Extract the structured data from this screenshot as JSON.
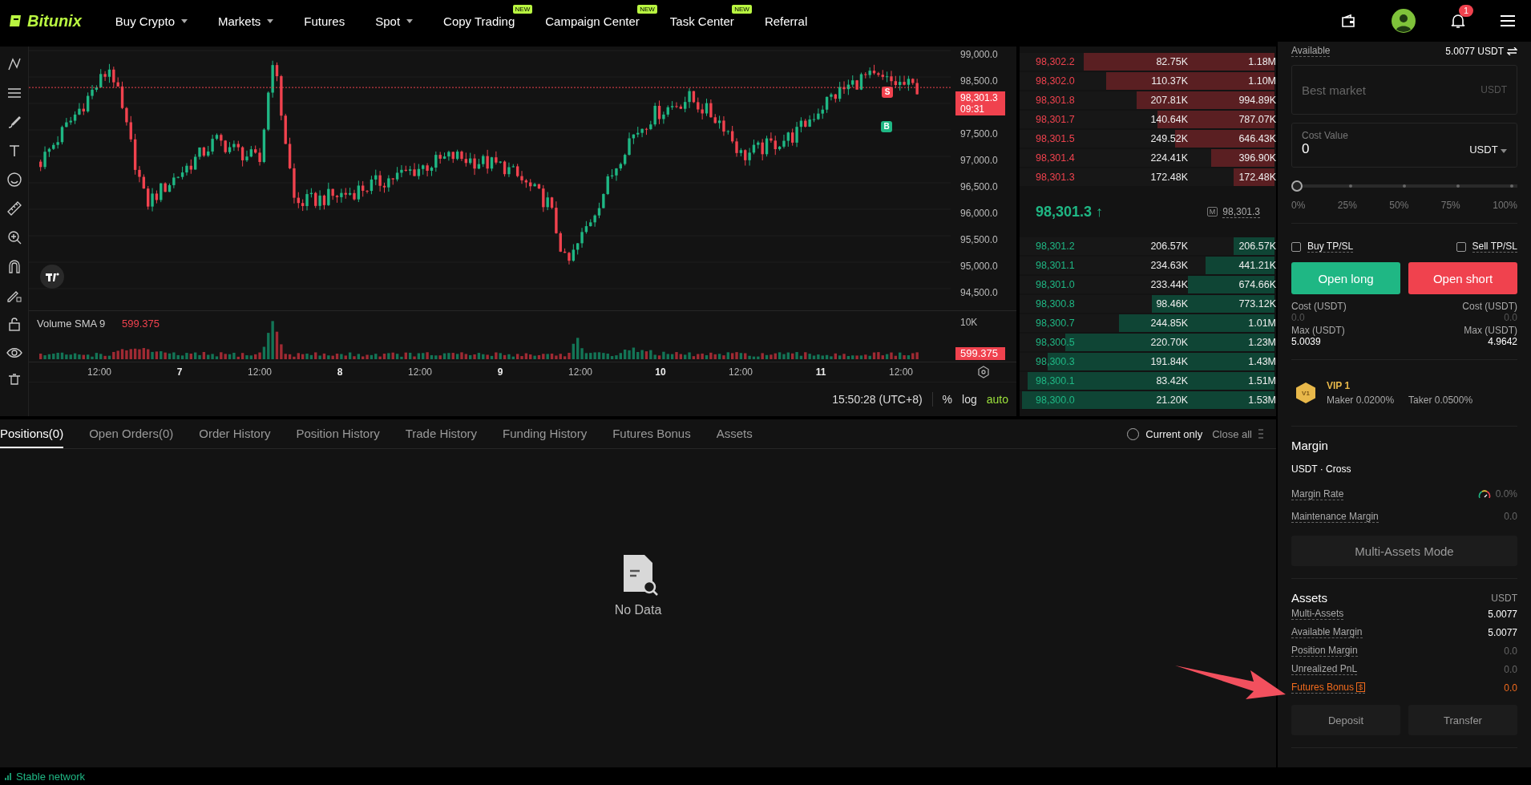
{
  "nav": {
    "logo": "Bitunix",
    "items": [
      {
        "label": "Buy Crypto",
        "dropdown": true
      },
      {
        "label": "Markets",
        "dropdown": true
      },
      {
        "label": "Futures",
        "dropdown": false
      },
      {
        "label": "Spot",
        "dropdown": true
      },
      {
        "label": "Copy Trading",
        "dropdown": false,
        "badge": "NEW"
      },
      {
        "label": "Campaign Center",
        "dropdown": false,
        "badge": "NEW"
      },
      {
        "label": "Task Center",
        "dropdown": false,
        "badge": "NEW"
      },
      {
        "label": "Referral",
        "dropdown": false
      }
    ],
    "notification_count": "1"
  },
  "chart": {
    "price_axis": [
      "99,000.0",
      "98,500.0",
      "97,500.0",
      "97,000.0",
      "96,500.0",
      "96,000.0",
      "95,500.0",
      "95,000.0",
      "94,500.0"
    ],
    "price_tag": {
      "price": "98,301.3",
      "countdown": "09:31"
    },
    "trade_markers": [
      {
        "label": "S",
        "kind": "sell"
      },
      {
        "label": "B",
        "kind": "buy"
      }
    ],
    "volume": {
      "label": "Volume SMA 9",
      "value": "599.375",
      "axis_label": "10K",
      "tag": "599.375"
    },
    "time_axis": [
      {
        "label": "12:00",
        "day": false
      },
      {
        "label": "7",
        "day": true
      },
      {
        "label": "12:00",
        "day": false
      },
      {
        "label": "8",
        "day": true
      },
      {
        "label": "12:00",
        "day": false
      },
      {
        "label": "9",
        "day": true
      },
      {
        "label": "12:00",
        "day": false
      },
      {
        "label": "10",
        "day": true
      },
      {
        "label": "12:00",
        "day": false
      },
      {
        "label": "11",
        "day": true
      },
      {
        "label": "12:00",
        "day": false
      }
    ],
    "clock": "15:50:28 (UTC+8)",
    "scale_options": [
      {
        "label": "%",
        "selected": false
      },
      {
        "label": "log",
        "selected": false
      },
      {
        "label": "auto",
        "selected": true
      }
    ]
  },
  "order_book": {
    "asks": [
      {
        "price": "98,302.2",
        "amount": "82.75K",
        "total": "1.18M",
        "level": 0.75
      },
      {
        "price": "98,302.0",
        "amount": "110.37K",
        "total": "1.10M",
        "level": 0.66
      },
      {
        "price": "98,301.8",
        "amount": "207.81K",
        "total": "994.89K",
        "level": 0.54
      },
      {
        "price": "98,301.7",
        "amount": "140.64K",
        "total": "787.07K",
        "level": 0.46
      },
      {
        "price": "98,301.5",
        "amount": "249.52K",
        "total": "646.43K",
        "level": 0.39
      },
      {
        "price": "98,301.4",
        "amount": "224.41K",
        "total": "396.90K",
        "level": 0.25
      },
      {
        "price": "98,301.3",
        "amount": "172.48K",
        "total": "172.48K",
        "level": 0.16
      }
    ],
    "last_price": "98,301.3",
    "last_arrow": "↑",
    "mark_icon": "M",
    "mark_price": "98,301.3",
    "bids": [
      {
        "price": "98,301.2",
        "amount": "206.57K",
        "total": "206.57K",
        "level": 0.16
      },
      {
        "price": "98,301.1",
        "amount": "234.63K",
        "total": "441.21K",
        "level": 0.27
      },
      {
        "price": "98,301.0",
        "amount": "233.44K",
        "total": "674.66K",
        "level": 0.34
      },
      {
        "price": "98,300.8",
        "amount": "98.46K",
        "total": "773.12K",
        "level": 0.48
      },
      {
        "price": "98,300.7",
        "amount": "244.85K",
        "total": "1.01M",
        "level": 0.61
      },
      {
        "price": "98,300.5",
        "amount": "220.70K",
        "total": "1.23M",
        "level": 0.82
      },
      {
        "price": "98,300.3",
        "amount": "191.84K",
        "total": "1.43M",
        "level": 0.89
      },
      {
        "price": "98,300.1",
        "amount": "83.42K",
        "total": "1.51M",
        "level": 0.97
      },
      {
        "price": "98,300.0",
        "amount": "21.20K",
        "total": "1.53M",
        "level": 0.99
      }
    ]
  },
  "order_form": {
    "available": {
      "label": "Available",
      "value": "5.0077 USDT"
    },
    "price_field": {
      "placeholder": "Best market",
      "unit": "USDT"
    },
    "cost_field": {
      "label": "Cost Value",
      "value": "0",
      "unit": "USDT"
    },
    "slider": {
      "level": 0,
      "marks": [
        "0%",
        "25%",
        "50%",
        "75%",
        "100%"
      ]
    },
    "tpsl": [
      {
        "label": "Buy TP/SL",
        "checked": false
      },
      {
        "label": "Sell TP/SL",
        "checked": false
      }
    ],
    "buttons": [
      {
        "label": "Open long",
        "kind": "long"
      },
      {
        "label": "Open short",
        "kind": "short"
      }
    ],
    "summary": [
      {
        "cost_label": "Cost (USDT)",
        "cost": "0.0",
        "max_label": "Max (USDT)",
        "max": "5.0039"
      },
      {
        "cost_label": "Cost (USDT)",
        "cost": "0.0",
        "max_label": "Max (USDT)",
        "max": "4.9642"
      }
    ]
  },
  "vip": {
    "level": "VIP 1",
    "badge": "V1",
    "maker": "Maker 0.0200%",
    "taker": "Taker 0.0500%"
  },
  "margin": {
    "title": "Margin",
    "mode": "USDT · Cross",
    "rows": [
      {
        "label": "Margin Rate",
        "value": "0.0%",
        "kind": "gauge"
      },
      {
        "label": "Maintenance Margin",
        "value": "0.0",
        "kind": "plain"
      }
    ],
    "mode_button": "Multi-Assets Mode"
  },
  "assets": {
    "title": "Assets",
    "unit": "USDT",
    "rows": [
      {
        "label": "Multi-Assets",
        "value": "5.0077",
        "kind": "bright"
      },
      {
        "label": "Available Margin",
        "value": "5.0077",
        "kind": "bright"
      },
      {
        "label": "Position Margin",
        "value": "0.0",
        "kind": "muted"
      },
      {
        "label": "Unrealized PnL",
        "value": "0.0",
        "kind": "muted"
      },
      {
        "label": "Futures Bonus",
        "value": "0.0",
        "kind": "bonus",
        "icon": "$"
      }
    ],
    "buttons": [
      "Deposit",
      "Transfer"
    ]
  },
  "bottom": {
    "tabs": [
      {
        "label": "Positions(0)",
        "selected": true
      },
      {
        "label": "Open Orders(0)",
        "selected": false
      },
      {
        "label": "Order History",
        "selected": false
      },
      {
        "label": "Position History",
        "selected": false
      },
      {
        "label": "Trade History",
        "selected": false
      },
      {
        "label": "Funding History",
        "selected": false
      },
      {
        "label": "Futures Bonus",
        "selected": false
      },
      {
        "label": "Assets",
        "selected": false
      }
    ],
    "current_only": {
      "label": "Current only",
      "checked": false
    },
    "close_all": "Close all",
    "empty_text": "No Data"
  },
  "status": {
    "text": "Stable network"
  }
}
